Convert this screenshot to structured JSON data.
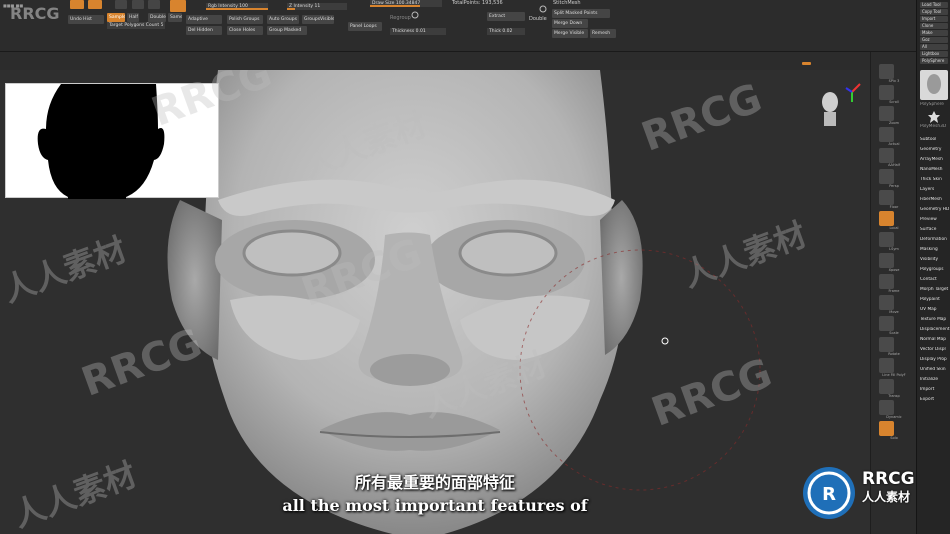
{
  "app": {
    "watermark_logo": "RRCG"
  },
  "toolbar": {
    "rgb_intensity": "Rgb Intensity 100",
    "z_intensity": "Z Intensity 11",
    "draw_size": "Draw Size 100.34847",
    "total_points": "TotalPoints: 193,536",
    "target_polygons": "Target Polygons Count 5",
    "half": "Half",
    "double": "Double",
    "same": "Same",
    "adaptive": "Adaptive",
    "undo_history": "Undo Hist",
    "del_hidden": "Del Hidden",
    "close_holes": "Close Holes",
    "group_masked": "Group Masked",
    "polish_groups": "Polish Groups",
    "auto_groups": "Auto Groups",
    "groups_visible": "GroupsVisible",
    "panel_loops": "Panel Loops",
    "regroup": "Regroup",
    "thickness": "Thickness 0.01",
    "extract": "Extract",
    "thick": "Thick 0.02",
    "double_btn": "Double",
    "stitch_mesh": "StitchMesh",
    "split_masked": "Split Masked Points",
    "merge_down": "Merge Down",
    "merge_visible": "Merge Visible",
    "remesh": "Remesh",
    "sample_btn": "Sample"
  },
  "shelf": {
    "items": [
      "SPix 3",
      "Scroll",
      "Zoom",
      "Actual",
      "AAHalf",
      "Persp",
      "Floor",
      "Local",
      "LSym",
      "Xpose",
      "Frame",
      "Move",
      "Scale",
      "Rotate",
      "Line Fill PolyF",
      "Transp",
      "Dynamic",
      "Solo"
    ]
  },
  "tray": {
    "top_buttons": [
      "Load Tool",
      "Copy Tool",
      "Import",
      "Clone",
      "Make",
      "Goz",
      "All",
      "Lightbox",
      "PolySphere"
    ],
    "tool_labels": [
      "PolySphere",
      "PolyMesh3D"
    ],
    "items": [
      "Subtool",
      "Geometry",
      "ArrayMesh",
      "NanoMesh",
      "Thick Skin",
      "Layers",
      "FiberMesh",
      "Geometry HD",
      "Preview",
      "Surface",
      "Deformation",
      "Masking",
      "Visibility",
      "Polygroups",
      "Contact",
      "Morph Target",
      "Polypaint",
      "UV Map",
      "Texture Map",
      "Displacement",
      "Normal Map",
      "Vector Displ",
      "Display Prop",
      "Unified Skin",
      "Initialize",
      "Import",
      "Export"
    ]
  },
  "subtitles": {
    "chinese": "所有最重要的面部特征",
    "english": "all the most important features of"
  },
  "watermarks": {
    "en": "RRCG",
    "cn": "人人素材"
  },
  "logo": {
    "title": "RRCG",
    "subtitle": "人人素材"
  },
  "colors": {
    "accent": "#d8842e",
    "background": "#2f2f2f",
    "head": "#bdbdbd"
  }
}
